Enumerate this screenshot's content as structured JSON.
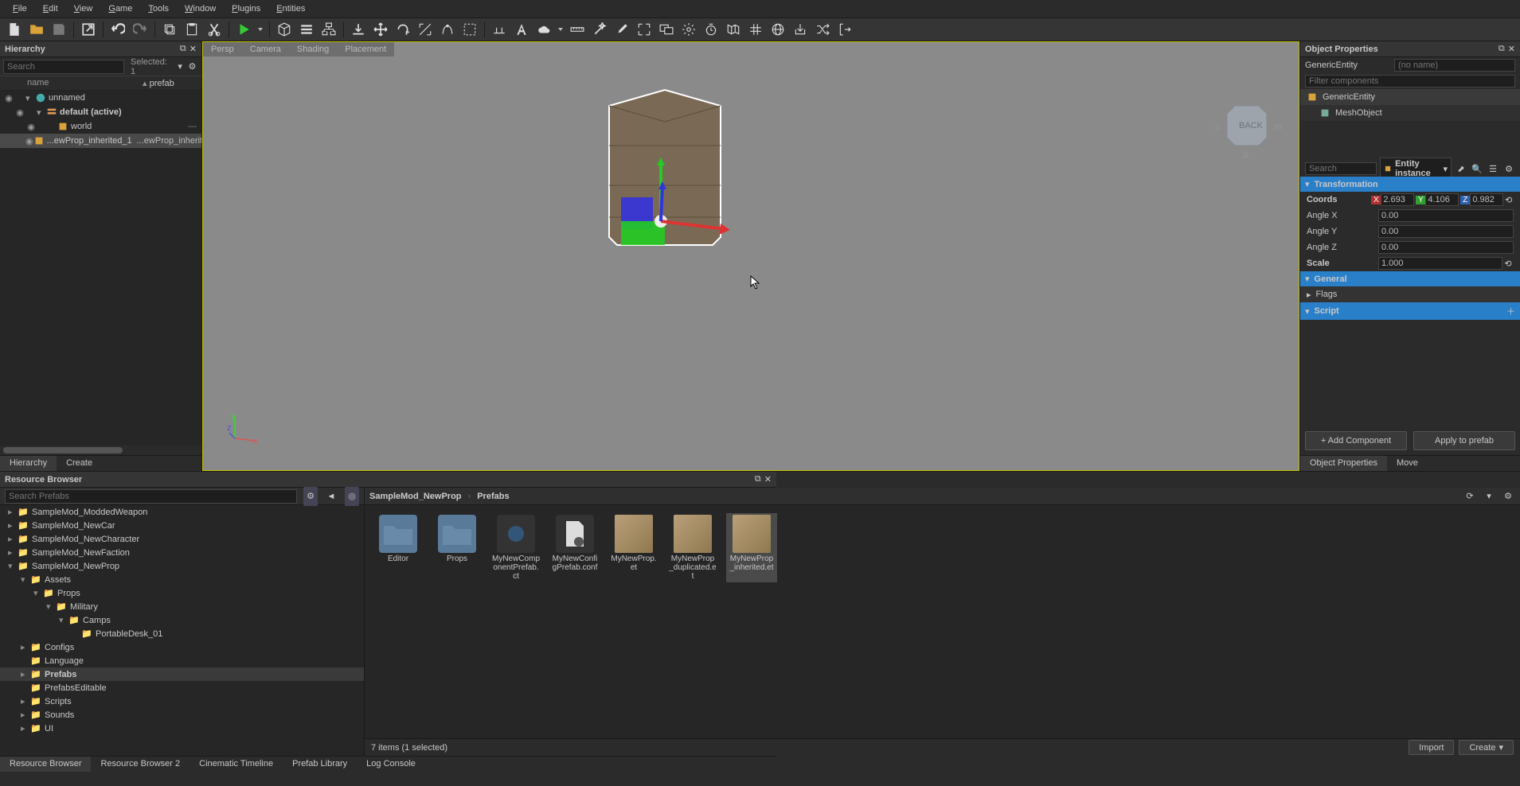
{
  "menu": {
    "file": "File",
    "edit": "Edit",
    "view": "View",
    "game": "Game",
    "tools": "Tools",
    "window": "Window",
    "plugins": "Plugins",
    "entities": "Entities"
  },
  "hierarchy": {
    "title": "Hierarchy",
    "search_placeholder": "Search",
    "selected": "Selected: 1",
    "col_name": "name",
    "col_prefab": "prefab",
    "rows": {
      "unnamed": "unnamed",
      "default": "default (active)",
      "world": "world",
      "world_prefab": "---",
      "inherited": "...ewProp_inherited_1",
      "inherited_prefab": "...ewProp_inherit"
    }
  },
  "viewport": {
    "tabs": {
      "persp": "Persp",
      "camera": "Camera",
      "shading": "Shading",
      "placement": "Placement"
    }
  },
  "props": {
    "title": "Object Properties",
    "entity_type": "GenericEntity",
    "entity_name_placeholder": "(no name)",
    "filter_placeholder": "Filter components",
    "comp_generic": "GenericEntity",
    "comp_mesh": "MeshObject",
    "search_placeholder": "Search",
    "scope": "Entity instance",
    "sec_transform": "Transformation",
    "lbl_coords": "Coords",
    "coords": {
      "x": "2.693",
      "y": "4.106",
      "z": "0.982"
    },
    "lbl_ax": "Angle X",
    "ax": "0.00",
    "lbl_ay": "Angle Y",
    "ay": "0.00",
    "lbl_az": "Angle Z",
    "az": "0.00",
    "lbl_scale": "Scale",
    "scale": "1.000",
    "sec_general": "General",
    "lbl_flags": "Flags",
    "sec_script": "Script",
    "btn_add": "+ Add Component",
    "btn_apply": "Apply to prefab",
    "tab_props": "Object Properties",
    "tab_move": "Move"
  },
  "rb": {
    "title": "Resource Browser",
    "search_placeholder": "Search Prefabs",
    "crumb1": "SampleMod_NewProp",
    "crumb2": "Prefabs",
    "tree": {
      "modded_weapon": "SampleMod_ModdedWeapon",
      "new_car": "SampleMod_NewCar",
      "new_character": "SampleMod_NewCharacter",
      "new_faction": "SampleMod_NewFaction",
      "new_prop": "SampleMod_NewProp",
      "assets": "Assets",
      "props": "Props",
      "military": "Military",
      "camps": "Camps",
      "portable": "PortableDesk_01",
      "configs": "Configs",
      "language": "Language",
      "prefabs": "Prefabs",
      "prefabs_editable": "PrefabsEditable",
      "scripts": "Scripts",
      "sounds": "Sounds",
      "ui": "UI"
    },
    "items": {
      "editor": "Editor",
      "props": "Props",
      "comp": "MyNewComponentPrefab.ct",
      "conf": "MyNewConfigPrefab.conf",
      "prop": "MyNewProp.et",
      "dup": "MyNewProp_duplicated.et",
      "inh": "MyNewProp_inherited.et"
    },
    "status": "7 items (1 selected)",
    "import": "Import",
    "create": "Create",
    "tab_rb": "Resource Browser",
    "tab_rb2": "Resource Browser 2",
    "tab_cine": "Cinematic Timeline",
    "tab_plib": "Prefab Library",
    "tab_log": "Log Console",
    "tab_hier": "Hierarchy",
    "tab_create": "Create"
  }
}
